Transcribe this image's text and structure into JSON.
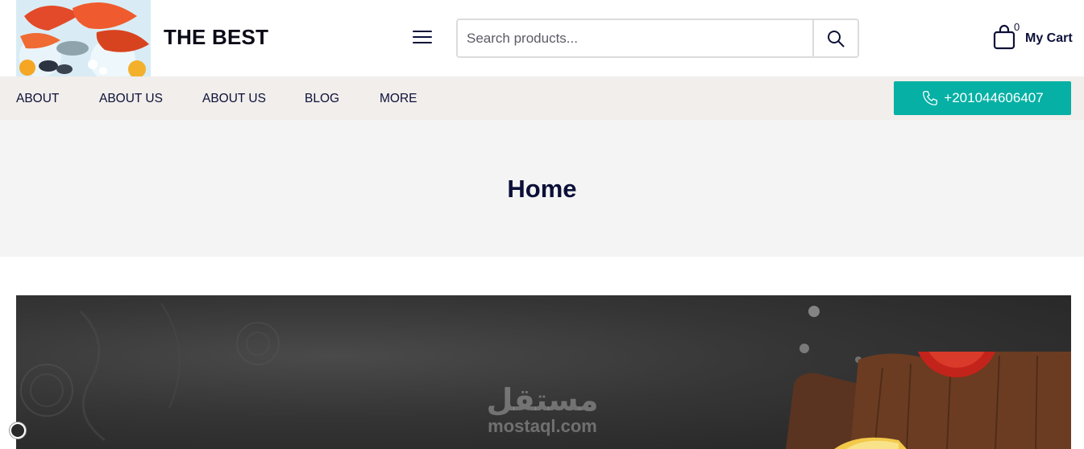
{
  "header": {
    "brand": "THE BEST",
    "search_placeholder": "Search products...",
    "cart_count": "0",
    "cart_label": "My Cart"
  },
  "nav": {
    "items": [
      "ABOUT",
      "ABOUT US",
      "ABOUT US",
      "BLOG",
      "MORE"
    ],
    "phone": "+201044606407"
  },
  "page": {
    "title": "Home"
  },
  "banner": {
    "watermark_ar": "مستقل",
    "watermark_en": "mostaql.com"
  },
  "colors": {
    "accent": "#06b0a4",
    "text_dark": "#0c1038",
    "nav_bg": "#f1eeeb",
    "title_band_bg": "#f4f4f4"
  }
}
